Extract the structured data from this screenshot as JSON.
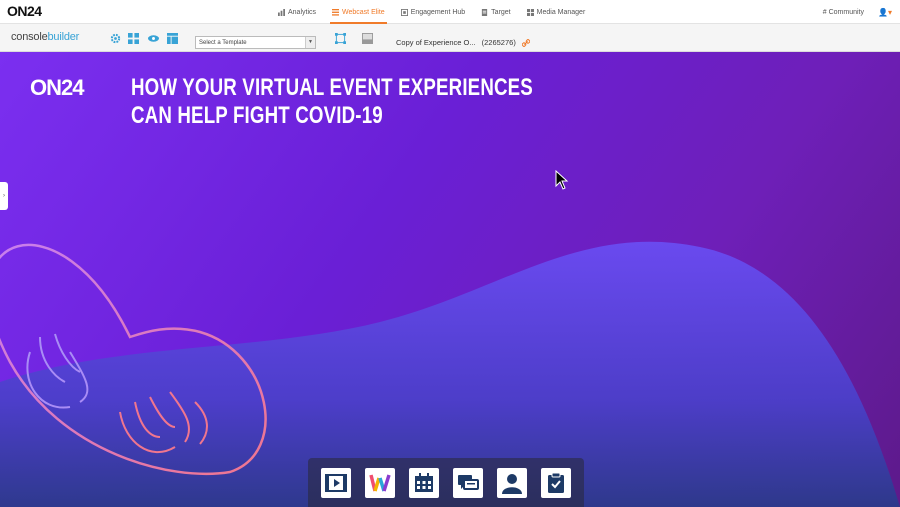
{
  "brand": {
    "logo": "ON24"
  },
  "nav": {
    "items": [
      {
        "label": "Analytics",
        "icon": "bar-chart-icon",
        "active": false
      },
      {
        "label": "Webcast Elite",
        "icon": "list-icon",
        "active": true
      },
      {
        "label": "Engagement Hub",
        "icon": "hub-icon",
        "active": false
      },
      {
        "label": "Target",
        "icon": "document-icon",
        "active": false
      },
      {
        "label": "Media Manager",
        "icon": "grid-icon",
        "active": false
      }
    ],
    "community": "Community",
    "user_caret": "▾"
  },
  "toolbar": {
    "app_name_part1": "console",
    "app_name_part2": "builder",
    "template_select": "Select a Template",
    "experience_title": "Copy of Experience O...",
    "experience_id": "(2265276)"
  },
  "stage": {
    "headline_line1": "HOW YOUR VIRTUAL EVENT EXPERIENCES",
    "headline_line2": "CAN HELP FIGHT COVID-19",
    "brand_logo": "ON24",
    "side_tab": "›"
  },
  "dock": {
    "items": [
      {
        "icon": "video-icon"
      },
      {
        "icon": "w-logo-icon"
      },
      {
        "icon": "calendar-icon"
      },
      {
        "icon": "chat-icon"
      },
      {
        "icon": "person-icon"
      },
      {
        "icon": "clipboard-icon"
      }
    ]
  },
  "colors": {
    "accent": "#f07b2a",
    "toolbar_blue": "#38a3d6",
    "stage_purple": "#6a1fd6",
    "wave_purple": "#4a3bd8",
    "heart_pink": "#e27fb6"
  }
}
